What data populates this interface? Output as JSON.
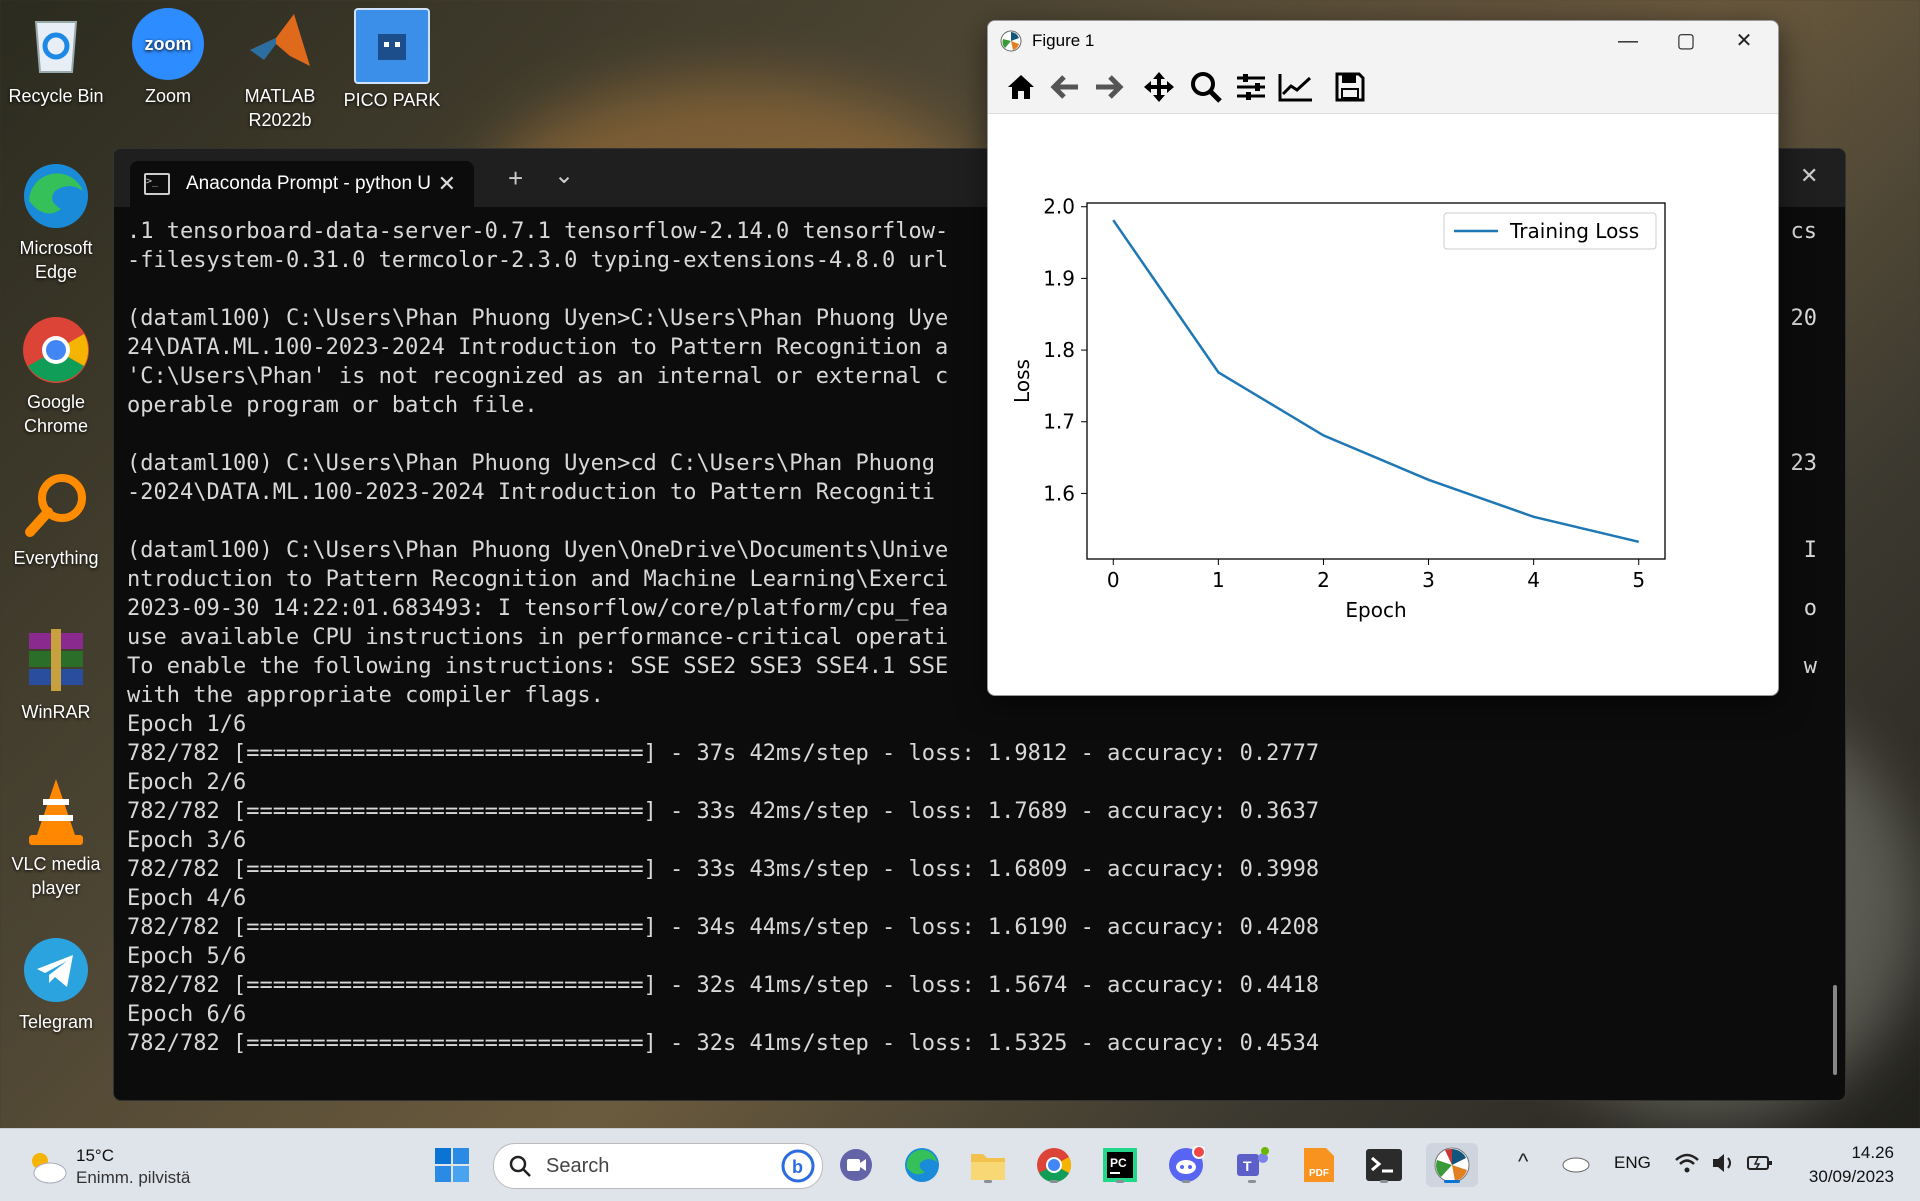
{
  "desktop": {
    "icons": [
      {
        "name": "recycle-bin",
        "label": "Recycle Bin"
      },
      {
        "name": "zoom",
        "label": "Zoom"
      },
      {
        "name": "matlab",
        "label": "MATLAB R2022b"
      },
      {
        "name": "pico-park",
        "label": "PICO PARK"
      },
      {
        "name": "microsoft-edge",
        "label": "Microsoft Edge"
      },
      {
        "name": "google-chrome",
        "label": "Google Chrome"
      },
      {
        "name": "everything",
        "label": "Everything"
      },
      {
        "name": "winrar",
        "label": "WinRAR"
      },
      {
        "name": "vlc",
        "label": "VLC media player"
      },
      {
        "name": "telegram",
        "label": "Telegram"
      }
    ]
  },
  "terminal": {
    "tab_title": "Anaconda Prompt - python  U",
    "new_tab": "+",
    "dropdown": "⌄",
    "close": "✕",
    "lines": [
      ".1 tensorboard-data-server-0.7.1 tensorflow-2.14.0 tensorflow-",
      "-filesystem-0.31.0 termcolor-2.3.0 typing-extensions-4.8.0 url",
      "",
      "(dataml100) C:\\Users\\Phan Phuong Uyen>C:\\Users\\Phan Phuong Uye",
      "24\\DATA.ML.100-2023-2024 Introduction to Pattern Recognition a",
      "'C:\\Users\\Phan' is not recognized as an internal or external c",
      "operable program or batch file.",
      "",
      "(dataml100) C:\\Users\\Phan Phuong Uyen>cd C:\\Users\\Phan Phuong",
      "-2024\\DATA.ML.100-2023-2024 Introduction to Pattern Recogniti",
      "",
      "(dataml100) C:\\Users\\Phan Phuong Uyen\\OneDrive\\Documents\\Unive",
      "ntroduction to Pattern Recognition and Machine Learning\\Exerci",
      "2023-09-30 14:22:01.683493: I tensorflow/core/platform/cpu_fea",
      "use available CPU instructions in performance-critical operati",
      "To enable the following instructions: SSE SSE2 SSE3 SSE4.1 SSE",
      "with the appropriate compiler flags.",
      "Epoch 1/6",
      "782/782 [==============================] - 37s 42ms/step - loss: 1.9812 - accuracy: 0.2777",
      "Epoch 2/6",
      "782/782 [==============================] - 33s 42ms/step - loss: 1.7689 - accuracy: 0.3637",
      "Epoch 3/6",
      "782/782 [==============================] - 33s 43ms/step - loss: 1.6809 - accuracy: 0.3998",
      "Epoch 4/6",
      "782/782 [==============================] - 34s 44ms/step - loss: 1.6190 - accuracy: 0.4208",
      "Epoch 5/6",
      "782/782 [==============================] - 32s 41ms/step - loss: 1.5674 - accuracy: 0.4418",
      "Epoch 6/6",
      "782/782 [==============================] - 32s 41ms/step - loss: 1.5325 - accuracy: 0.4534"
    ],
    "right_fragments": [
      {
        "line": 0,
        "text": "cs"
      },
      {
        "line": 3,
        "text": "20"
      },
      {
        "line": 8,
        "text": "23"
      },
      {
        "line": 11,
        "text": "I"
      },
      {
        "line": 13,
        "text": "o"
      },
      {
        "line": 15,
        "text": "w"
      }
    ]
  },
  "figure": {
    "title": "Figure 1",
    "toolbar": [
      "home-icon",
      "back-arrow-icon",
      "forward-arrow-icon",
      "pan-icon",
      "zoom-icon",
      "configure-subplots-icon",
      "edit-axis-icon",
      "save-icon"
    ]
  },
  "chart_data": {
    "type": "line",
    "title": "",
    "xlabel": "Epoch",
    "ylabel": "Loss",
    "x": [
      0,
      1,
      2,
      3,
      4,
      5
    ],
    "series": [
      {
        "name": "Training Loss",
        "values": [
          1.9812,
          1.7689,
          1.6809,
          1.619,
          1.5674,
          1.5325
        ],
        "color": "#1f77b4"
      }
    ],
    "xticks": [
      "0",
      "1",
      "2",
      "3",
      "4",
      "5"
    ],
    "yticks": [
      "1.6",
      "1.7",
      "1.8",
      "1.9",
      "2.0"
    ],
    "ylim": [
      1.5085,
      2.0052
    ],
    "xlim": [
      -0.25,
      5.25
    ],
    "legend": "upper-right",
    "grid": false
  },
  "taskbar": {
    "weather_temp": "15°C",
    "weather_desc": "Enimm. pilvistä",
    "search_placeholder": "Search",
    "language": "ENG",
    "time": "14.26",
    "date": "30/09/2023",
    "apps": [
      "start",
      "search",
      "teams-meet",
      "edge",
      "file-explorer",
      "chrome",
      "pycharm",
      "discord",
      "teams",
      "pdf-reader",
      "terminal",
      "matplotlib-figure"
    ]
  },
  "colors": {
    "taskbar": "#dfe3ea",
    "terminal_bg": "#0c0c0c",
    "line": "#1f77b4"
  }
}
